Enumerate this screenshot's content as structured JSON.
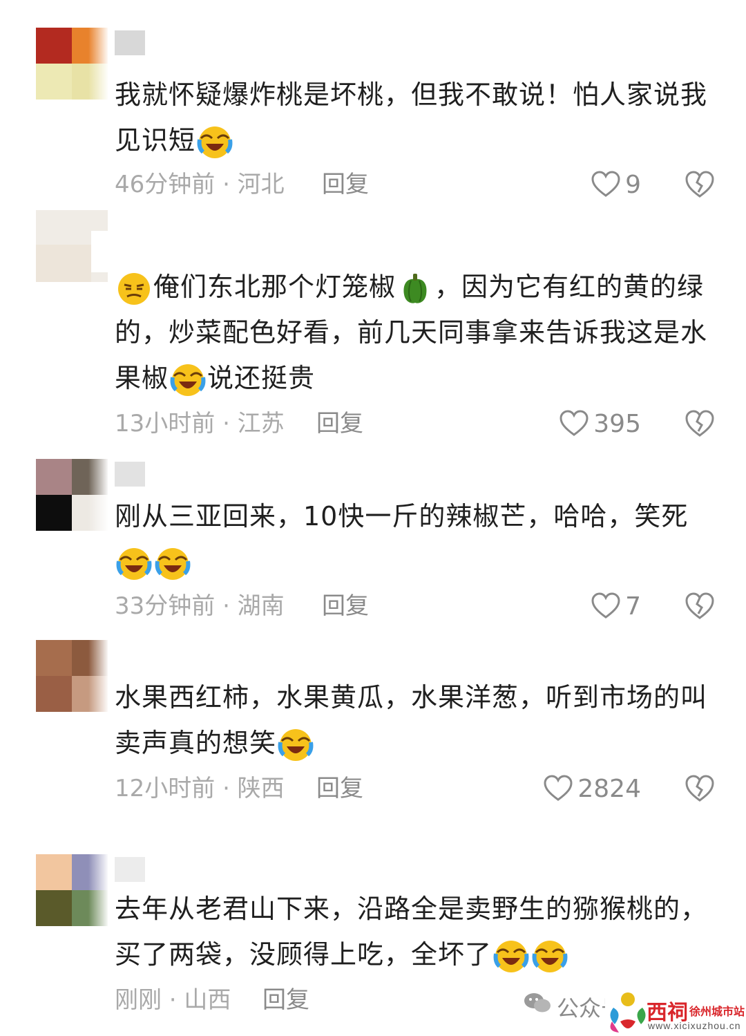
{
  "comments": [
    {
      "text_parts": [
        "我就怀疑爆炸桃是坏桃，但我不敢说！怕人家说我见识短"
      ],
      "meta": "46分钟前 · 河北",
      "reply": "回复",
      "likes": "9"
    },
    {
      "text_a": "俺们东北那个灯笼椒",
      "text_b": "，因为它有红的黄的绿的，炒菜配色好看，前几天同事拿来告诉我这是水果椒",
      "text_c": "说还挺贵",
      "meta": "13小时前 · 江苏",
      "reply": "回复",
      "likes": "395"
    },
    {
      "text_a": "刚从三亚回来，10快一斤的辣椒芒，哈哈，笑死",
      "meta": "33分钟前 · 湖南",
      "reply": "回复",
      "likes": "7"
    },
    {
      "text_a": "水果西红柿，水果黄瓜，水果洋葱，听到市场的叫卖声真的想笑",
      "meta": "12小时前 · 陕西",
      "reply": "回复",
      "likes": "2824"
    },
    {
      "text_a": "去年从老君山下来，沿路全是卖野生的猕猴桃的，买了两袋，没顾得上吃，全坏了",
      "meta": "刚刚 · 山西",
      "reply": "回复"
    }
  ],
  "watermark": {
    "wechat_label": "公众号",
    "site_name": "西祠",
    "site_sub": "徐州城市站",
    "site_url": "www.xicixuzhou.cn"
  },
  "colors": {
    "text": "#1f1f1f",
    "meta": "#a9a9a9",
    "action": "#8a8a8a",
    "emoji_face": "#f7c21b",
    "site_red": "#d9262b"
  },
  "icons": [
    "laughing-crying-emoji-icon",
    "smirk-emoji-icon",
    "bell-pepper-emoji-icon",
    "heart-outline-icon",
    "broken-heart-icon",
    "wechat-icon",
    "site-logo-icon"
  ]
}
